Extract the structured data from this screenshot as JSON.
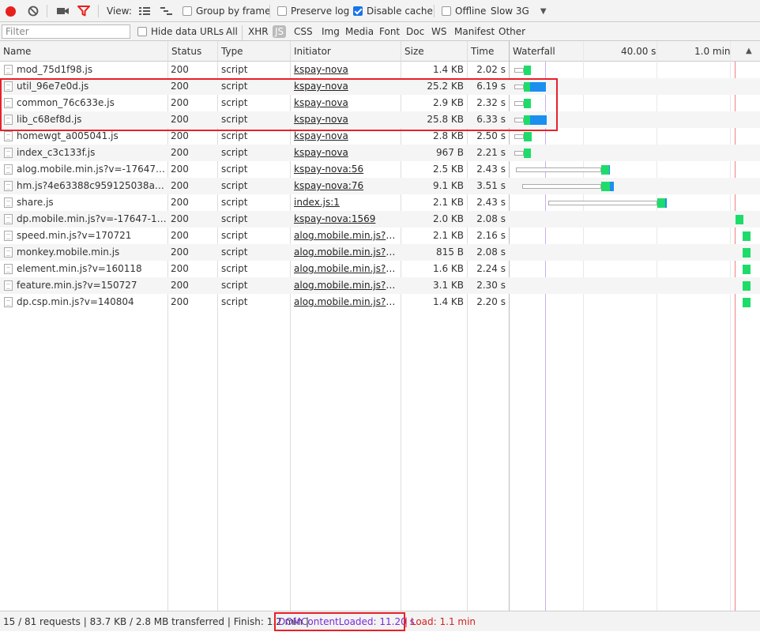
{
  "toolbar": {
    "view_label": "View:",
    "group_by_frame": {
      "label": "Group by frame",
      "checked": false
    },
    "preserve_log": {
      "label": "Preserve log",
      "checked": false
    },
    "disable_cache": {
      "label": "Disable cache",
      "checked": true
    },
    "offline": {
      "label": "Offline",
      "checked": false
    },
    "throttle": "Slow 3G"
  },
  "filterbar": {
    "placeholder": "Filter",
    "hide_data_urls": "Hide data URLs",
    "types": [
      "All",
      "XHR",
      "JS",
      "CSS",
      "Img",
      "Media",
      "Font",
      "Doc",
      "WS",
      "Manifest",
      "Other"
    ],
    "active_type": "JS"
  },
  "columns": {
    "name": "Name",
    "status": "Status",
    "type": "Type",
    "initiator": "Initiator",
    "size": "Size",
    "time": "Time",
    "waterfall": "Waterfall",
    "tick_1": "40.00 s",
    "tick_2": "1.0 min",
    "sort_icon": "sort-asc-icon"
  },
  "rows": [
    {
      "name": "mod_75d1f98.js",
      "status": "200",
      "type": "script",
      "initiator": "kspay-nova",
      "size": "1.4 KB",
      "time": "2.02 s"
    },
    {
      "name": "util_96e7e0d.js",
      "status": "200",
      "type": "script",
      "initiator": "kspay-nova",
      "size": "25.2 KB",
      "time": "6.19 s"
    },
    {
      "name": "common_76c633e.js",
      "status": "200",
      "type": "script",
      "initiator": "kspay-nova",
      "size": "2.9 KB",
      "time": "2.32 s"
    },
    {
      "name": "lib_c68ef8d.js",
      "status": "200",
      "type": "script",
      "initiator": "kspay-nova",
      "size": "25.8 KB",
      "time": "6.33 s"
    },
    {
      "name": "homewgt_a005041.js",
      "status": "200",
      "type": "script",
      "initiator": "kspay-nova",
      "size": "2.8 KB",
      "time": "2.50 s"
    },
    {
      "name": "index_c3c133f.js",
      "status": "200",
      "type": "script",
      "initiator": "kspay-nova",
      "size": "967 B",
      "time": "2.21 s"
    },
    {
      "name": "alog.mobile.min.js?v=-17647-17...",
      "status": "200",
      "type": "script",
      "initiator": "kspay-nova:56",
      "size": "2.5 KB",
      "time": "2.43 s"
    },
    {
      "name": "hm.js?4e63388c959125038aaba...",
      "status": "200",
      "type": "script",
      "initiator": "kspay-nova:76",
      "size": "9.1 KB",
      "time": "3.51 s"
    },
    {
      "name": "share.js",
      "status": "200",
      "type": "script",
      "initiator": "index.js:1",
      "size": "2.1 KB",
      "time": "2.43 s"
    },
    {
      "name": "dp.mobile.min.js?v=-17647-17647",
      "status": "200",
      "type": "script",
      "initiator": "kspay-nova:1569",
      "size": "2.0 KB",
      "time": "2.08 s"
    },
    {
      "name": "speed.min.js?v=170721",
      "status": "200",
      "type": "script",
      "initiator": "alog.mobile.min.js?v=...",
      "size": "2.1 KB",
      "time": "2.16 s"
    },
    {
      "name": "monkey.mobile.min.js",
      "status": "200",
      "type": "script",
      "initiator": "alog.mobile.min.js?v=...",
      "size": "815 B",
      "time": "2.08 s"
    },
    {
      "name": "element.min.js?v=160118",
      "status": "200",
      "type": "script",
      "initiator": "alog.mobile.min.js?v=...",
      "size": "1.6 KB",
      "time": "2.24 s"
    },
    {
      "name": "feature.min.js?v=150727",
      "status": "200",
      "type": "script",
      "initiator": "alog.mobile.min.js?v=...",
      "size": "3.1 KB",
      "time": "2.30 s"
    },
    {
      "name": "dp.csp.min.js?v=140804",
      "status": "200",
      "type": "script",
      "initiator": "alog.mobile.min.js?v=...",
      "size": "1.4 KB",
      "time": "2.20 s"
    }
  ],
  "statusbar": {
    "summary": "15 / 81 requests | 83.7 KB / 2.8 MB transferred | Finish: 1.2 min |",
    "dom_content_loaded": "DOMContentLoaded: 11.20 s",
    "load": "| Load: 1.1 min"
  },
  "colors": {
    "record": "#e8201a",
    "filter_active": "#e8201a",
    "waterfall_receiving": "#1edc6a",
    "waterfall_downloading": "#1a8ff0",
    "dom_line": "#c9b0f0",
    "load_line": "#f08080",
    "highlight": "#e8202a"
  }
}
